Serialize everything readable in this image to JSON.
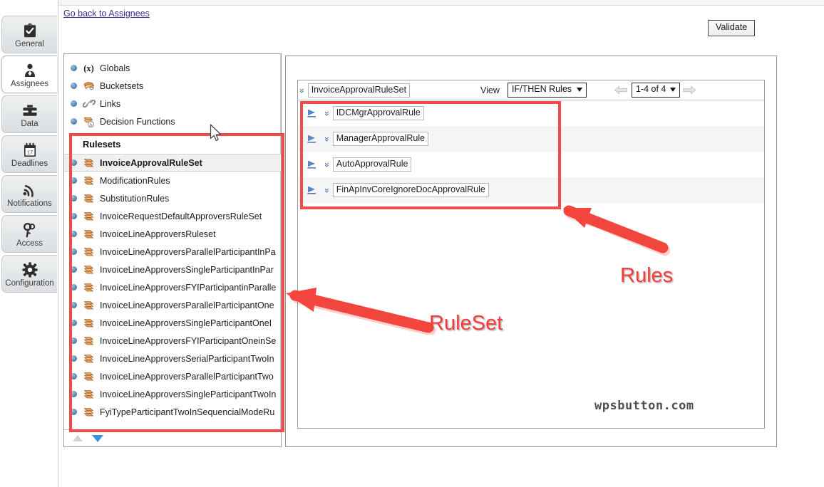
{
  "window": {
    "back_link": "Go back to Assignees",
    "validate_button": "Validate"
  },
  "rail": {
    "items": [
      {
        "label": "General",
        "icon": "clipboard-check-icon",
        "active": false
      },
      {
        "label": "Assignees",
        "icon": "person-icon",
        "active": true
      },
      {
        "label": "Data",
        "icon": "briefcase-icon",
        "active": false
      },
      {
        "label": "Deadlines",
        "icon": "calendar-icon",
        "active": false
      },
      {
        "label": "Notifications",
        "icon": "rss-icon",
        "active": false
      },
      {
        "label": "Access",
        "icon": "key-icon",
        "active": false
      },
      {
        "label": "Configuration",
        "icon": "gear-icon",
        "active": false
      }
    ]
  },
  "explorer": {
    "top_nodes": [
      {
        "label": "Globals",
        "icon": "variable-x-icon"
      },
      {
        "label": "Bucketsets",
        "icon": "bucketset-icon"
      },
      {
        "label": "Links",
        "icon": "link-icon"
      },
      {
        "label": "Decision Functions",
        "icon": "decision-function-icon"
      }
    ],
    "section_header": "Rulesets",
    "rulesets": [
      {
        "label": "InvoiceApprovalRuleSet",
        "selected": true
      },
      {
        "label": "ModificationRules",
        "selected": false
      },
      {
        "label": "SubstitutionRules",
        "selected": false
      },
      {
        "label": "InvoiceRequestDefaultApproversRuleSet",
        "selected": false
      },
      {
        "label": "InvoiceLineApproversRuleset",
        "selected": false
      },
      {
        "label": "InvoiceLineApproversParallelParticipantInPa",
        "selected": false
      },
      {
        "label": "InvoiceLineApproversSingleParticipantInPar",
        "selected": false
      },
      {
        "label": "InvoiceLineApproversFYIParticipantinParalle",
        "selected": false
      },
      {
        "label": "InvoiceLineApproversParallelParticipantOne",
        "selected": false
      },
      {
        "label": "InvoiceLineApproversSingleParticipantOneI",
        "selected": false
      },
      {
        "label": "InvoiceLineApproversFYIParticipantOneinSe",
        "selected": false
      },
      {
        "label": "InvoiceLineApproversSerialParticipantTwoIn",
        "selected": false
      },
      {
        "label": "InvoiceLineApproversParallelParticipantTwo",
        "selected": false
      },
      {
        "label": "InvoiceLineApproversSingleParticipantTwoIn",
        "selected": false
      },
      {
        "label": "FyiTypeParticipantTwoInSequencialModeRu",
        "selected": false
      }
    ],
    "scroll_up": "scroll-up",
    "scroll_down": "scroll-down"
  },
  "editor": {
    "ruleset_name": "InvoiceApprovalRuleSet",
    "view_label": "View",
    "view_value": "IF/THEN Rules",
    "pager_value": "1-4 of 4",
    "rules": [
      {
        "name": "IDCMgrApprovalRule"
      },
      {
        "name": "ManagerApprovalRule"
      },
      {
        "name": "AutoApprovalRule"
      },
      {
        "name": "FinApInvCoreIgnoreDocApprovalRule"
      }
    ]
  },
  "annotations": {
    "rules_label": "Rules",
    "ruleset_label": "RuleSet",
    "watermark": "wpsbutton.com",
    "highlight_color": "#f04a4a",
    "label_color": "#ff3a3a"
  }
}
